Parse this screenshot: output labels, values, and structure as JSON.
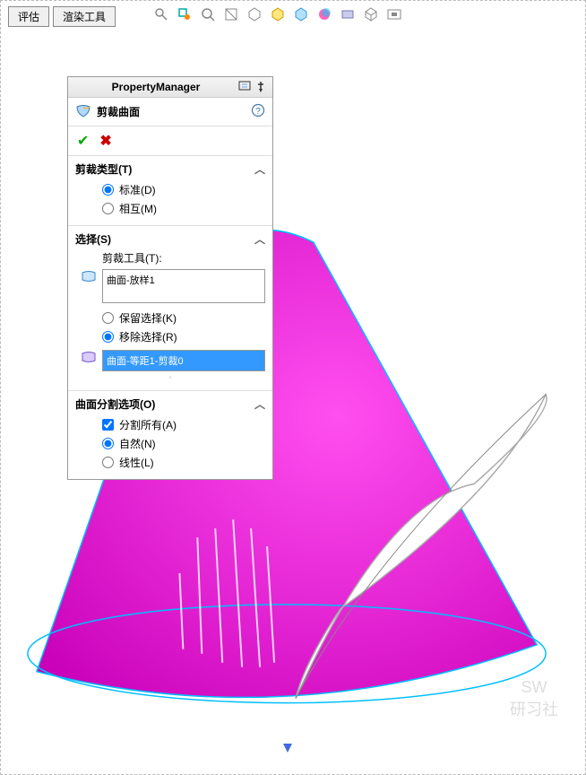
{
  "menu": {
    "evaluate": "评估",
    "render_tools": "渲染工具"
  },
  "pm": {
    "title": "PropertyManager",
    "feature_name": "剪裁曲面"
  },
  "sections": {
    "trim_type": {
      "title": "剪裁类型(T)",
      "standard": "标准(D)",
      "mutual": "相互(M)"
    },
    "selection": {
      "title": "选择(S)",
      "trim_tools_label": "剪裁工具(T):",
      "tool_entry": "曲面-放样1",
      "keep": "保留选择(K)",
      "remove": "移除选择(R)",
      "highlight_entry": "曲面-等距1-剪裁0"
    },
    "split_options": {
      "title": "曲面分割选项(O)",
      "split_all": "分割所有(A)",
      "natural": "自然(N)",
      "linear": "线性(L)"
    }
  },
  "watermark": {
    "line1": "SW",
    "line2": "研习社"
  }
}
